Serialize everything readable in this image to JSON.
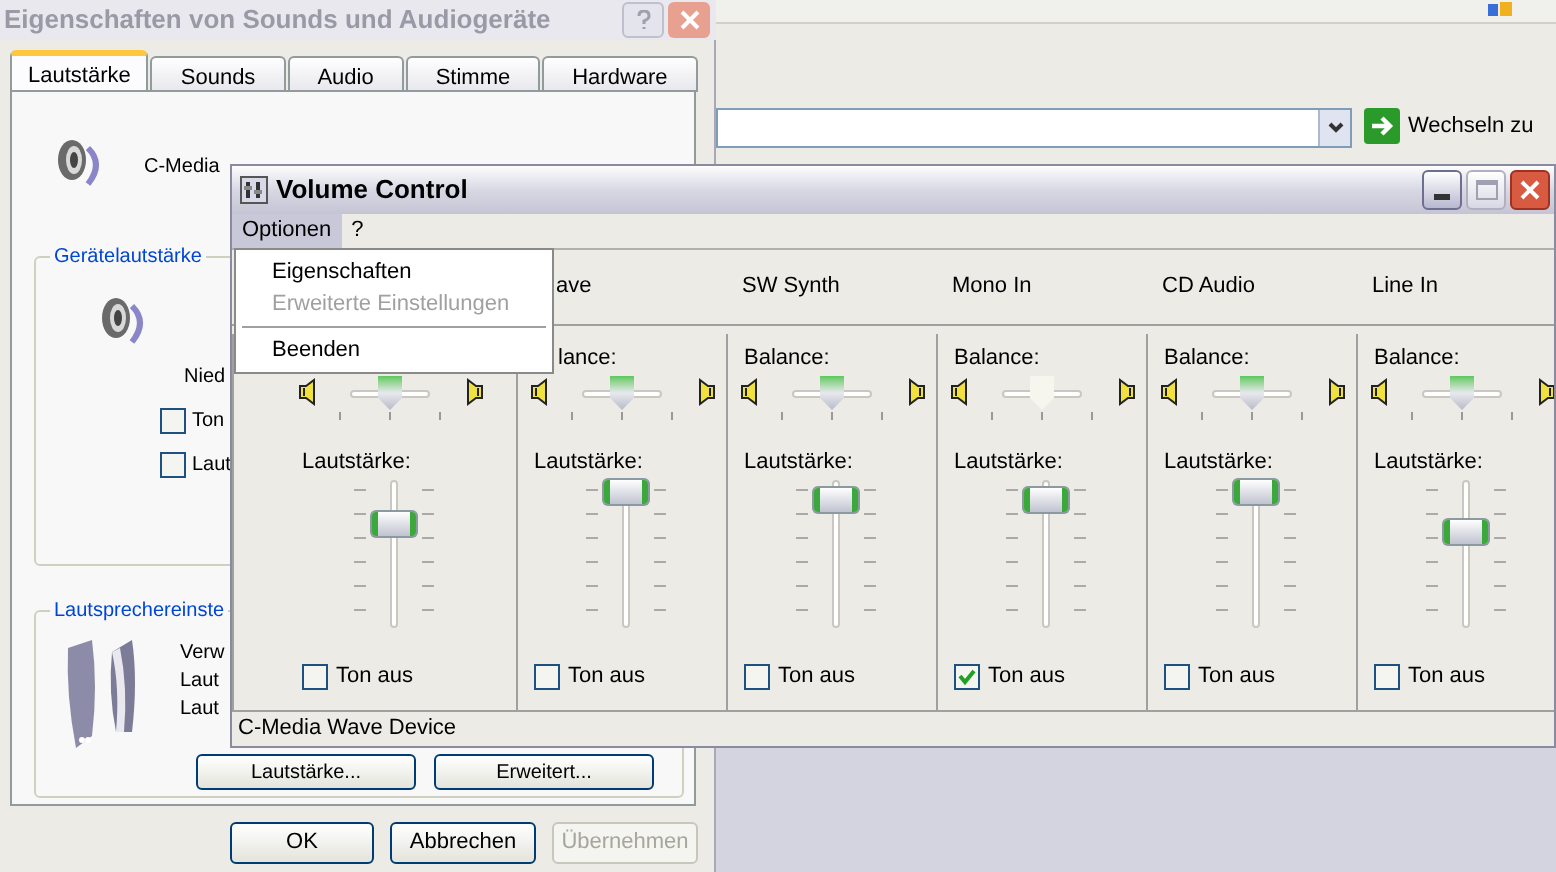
{
  "properties_window": {
    "title": "Eigenschaften von Sounds und Audiogeräte",
    "tabs": [
      {
        "label": "Lautstärke",
        "selected": true
      },
      {
        "label": "Sounds",
        "selected": false
      },
      {
        "label": "Audio",
        "selected": false
      },
      {
        "label": "Stimme",
        "selected": false
      },
      {
        "label": "Hardware",
        "selected": false
      }
    ],
    "device_name": "C-Media",
    "device_group": "Gerätelautstärke",
    "low_label": "Nied",
    "checkboxes": [
      {
        "label": "Ton",
        "checked": false
      },
      {
        "label": "Laut",
        "checked": false
      }
    ],
    "speaker_group": "Lautsprechereinste",
    "speaker_lines": [
      "Verw",
      "Laut",
      "Laut"
    ],
    "speaker_buttons": [
      "Lautstärke...",
      "Erweitert..."
    ],
    "buttons": [
      {
        "label": "OK",
        "disabled": false
      },
      {
        "label": "Abbrechen",
        "disabled": false
      },
      {
        "label": "Übernehmen",
        "disabled": true
      }
    ]
  },
  "browser": {
    "go_button": "Wechseln zu"
  },
  "volume_control": {
    "title": "Volume Control",
    "menu": [
      {
        "label": "Optionen",
        "selected": true
      },
      {
        "label": "?",
        "selected": false
      }
    ],
    "dropdown": [
      {
        "kind": "item",
        "label": "Eigenschaften",
        "disabled": false
      },
      {
        "kind": "item",
        "label": "Erweiterte Einstellungen",
        "disabled": true
      },
      {
        "kind": "separator"
      },
      {
        "kind": "item",
        "label": "Beenden",
        "disabled": false
      }
    ],
    "columns": [
      {
        "balance": {
          "level": 0.5
        },
        "volume": {
          "label": "Lautstärke:",
          "level": 0.75
        },
        "mute_label": "Ton aus",
        "muted": false
      },
      {
        "name": "ave",
        "balance": {
          "label": "lance:",
          "level": 0.5
        },
        "volume": {
          "label": "Lautstärke:",
          "level": 1
        },
        "mute_label": "Ton aus",
        "muted": false
      },
      {
        "name": "SW Synth",
        "balance": {
          "label": "Balance:",
          "level": 0.5
        },
        "volume": {
          "label": "Lautstärke:",
          "level": 0.93
        },
        "mute_label": "Ton aus",
        "muted": false
      },
      {
        "name": "Mono In",
        "balance": {
          "label": "Balance:",
          "level": 0.5
        },
        "volume": {
          "label": "Lautstärke:",
          "level": 0.93
        },
        "mute_label": "Ton aus",
        "muted": true
      },
      {
        "name": "CD Audio",
        "balance": {
          "label": "Balance:",
          "level": 0.5
        },
        "volume": {
          "label": "Lautstärke:",
          "level": 1
        },
        "mute_label": "Ton aus",
        "muted": false
      },
      {
        "name": "Line In",
        "balance": {
          "label": "Balance:",
          "level": 0.5
        },
        "volume": {
          "label": "Lautstärke:",
          "level": 0.68
        },
        "mute_label": "Ton aus",
        "muted": false
      }
    ],
    "status_bar": "C-Media Wave Device"
  }
}
